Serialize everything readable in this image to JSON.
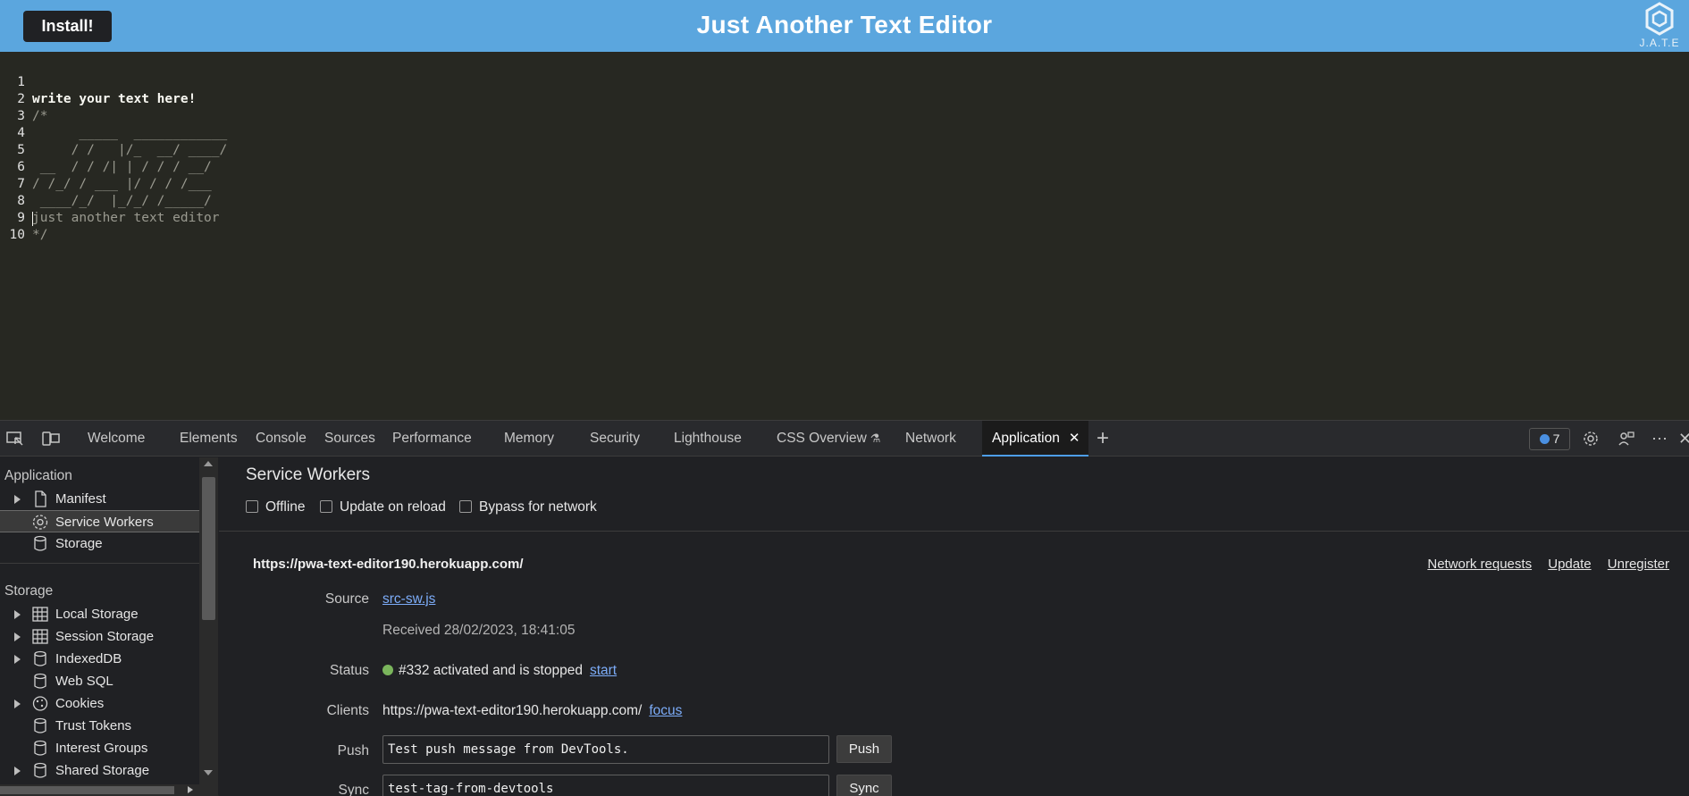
{
  "app": {
    "install_label": "Install!",
    "title": "Just Another Text Editor",
    "logo_text": "J.A.T.E"
  },
  "editor": {
    "lines": [
      {
        "n": "1",
        "text": "write your text here!"
      },
      {
        "n": "2",
        "text": "/*"
      },
      {
        "n": "3",
        "text": "      _____  ____________"
      },
      {
        "n": "4",
        "text": "     / /   |/_  __/ ____/"
      },
      {
        "n": "5",
        "text": " __  / / /| | / / / __/"
      },
      {
        "n": "6",
        "text": "/ /_/ / ___ |/ / / /___"
      },
      {
        "n": "7",
        "text": " ____/_/  |_/_/ /_____/"
      },
      {
        "n": "8",
        "text": "just another text editor"
      },
      {
        "n": "9",
        "text": "*/"
      },
      {
        "n": "10",
        "text": ""
      }
    ]
  },
  "devtools": {
    "tabs": [
      "Welcome",
      "Elements",
      "Console",
      "Sources",
      "Performance",
      "Memory",
      "Security",
      "Lighthouse",
      "CSS Overview",
      "Network",
      "Application"
    ],
    "active_tab": "Application",
    "issues_count": "7",
    "sidebar": {
      "application_header": "Application",
      "application_items": [
        "Manifest",
        "Service Workers",
        "Storage"
      ],
      "storage_header": "Storage",
      "storage_items": [
        "Local Storage",
        "Session Storage",
        "IndexedDB",
        "Web SQL",
        "Cookies",
        "Trust Tokens",
        "Interest Groups",
        "Shared Storage"
      ]
    },
    "main": {
      "title": "Service Workers",
      "options": [
        "Offline",
        "Update on reload",
        "Bypass for network"
      ],
      "sw_url": "https://pwa-text-editor190.herokuapp.com/",
      "links": [
        "Network requests",
        "Update",
        "Unregister"
      ],
      "source_label": "Source",
      "source_file": "src-sw.js",
      "received": "Received 28/02/2023, 18:41:05",
      "status_label": "Status",
      "status_text": "#332 activated and is stopped",
      "status_action": "start",
      "clients_label": "Clients",
      "clients_url": "https://pwa-text-editor190.herokuapp.com/",
      "clients_action": "focus",
      "push_label": "Push",
      "push_value": "Test push message from DevTools.",
      "push_button": "Push",
      "sync_label": "Sync",
      "sync_value": "test-tag-from-devtools",
      "sync_button": "Sync"
    }
  }
}
